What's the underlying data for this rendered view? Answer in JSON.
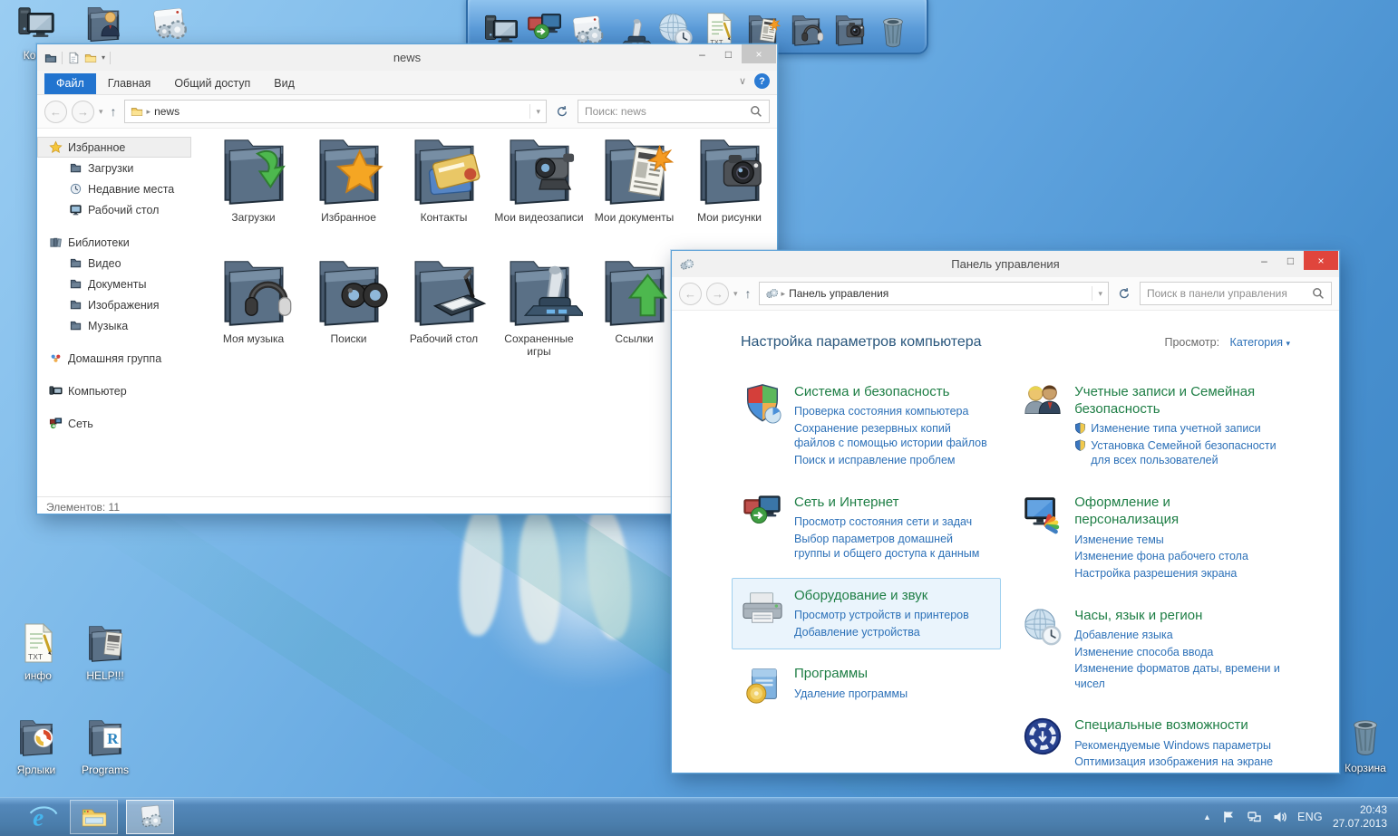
{
  "glyphs": {
    "minimize": "–",
    "maximize": "□",
    "close": "×",
    "help": "?",
    "ribbon_collapse": "∨",
    "back": "←",
    "forward": "→",
    "up": "↑",
    "dropdown": "▾",
    "breadcrumb": "▸",
    "tray_expand": "▲"
  },
  "desktop": {
    "top_icons": [
      {
        "label": "Комп",
        "icon": "computer"
      },
      {
        "label": "",
        "icon": "user-folder"
      },
      {
        "label": "",
        "icon": "settings-box"
      }
    ],
    "bottom_left_icons": [
      {
        "label": "инфо",
        "icon": "txt-file"
      },
      {
        "label": "HELP!!!",
        "icon": "help-folder"
      },
      {
        "label": "Ярлыки",
        "icon": "shortcuts-folder"
      },
      {
        "label": "Programs",
        "icon": "programs-folder"
      }
    ],
    "recycle_bin": {
      "label": "Корзина",
      "icon": "recycle-bin"
    }
  },
  "dock": {
    "icons": [
      "computer",
      "network-places",
      "settings-box",
      "joystick-device",
      "globe-clock",
      "txt-file",
      "folder-news",
      "folder-music",
      "folder-photo",
      "recycle-bin"
    ]
  },
  "news_window": {
    "title": "news",
    "tabs": [
      {
        "label": "Файл",
        "active": true
      },
      {
        "label": "Главная",
        "active": false
      },
      {
        "label": "Общий доступ",
        "active": false
      },
      {
        "label": "Вид",
        "active": false
      }
    ],
    "address": "news",
    "search_placeholder": "Поиск: news",
    "sidebar": [
      {
        "label": "Избранное",
        "icon": "star-mini",
        "level": 0,
        "selected": true,
        "gap": false
      },
      {
        "label": "Загрузки",
        "icon": "folder-mini",
        "level": 1,
        "selected": false,
        "gap": false
      },
      {
        "label": "Недавние места",
        "icon": "recent-mini",
        "level": 1,
        "selected": false,
        "gap": false
      },
      {
        "label": "Рабочий стол",
        "icon": "monitor-mini",
        "level": 1,
        "selected": false,
        "gap": false
      },
      {
        "label": "Библиотеки",
        "icon": "libraries-mini",
        "level": 0,
        "selected": false,
        "gap": true
      },
      {
        "label": "Видео",
        "icon": "folder-mini",
        "level": 1,
        "selected": false,
        "gap": false
      },
      {
        "label": "Документы",
        "icon": "folder-mini",
        "level": 1,
        "selected": false,
        "gap": false
      },
      {
        "label": "Изображения",
        "icon": "folder-mini",
        "level": 1,
        "selected": false,
        "gap": false
      },
      {
        "label": "Музыка",
        "icon": "folder-mini",
        "level": 1,
        "selected": false,
        "gap": false
      },
      {
        "label": "Домашняя группа",
        "icon": "homegroup-mini",
        "level": 0,
        "selected": false,
        "gap": true
      },
      {
        "label": "Компьютер",
        "icon": "computer-mini",
        "level": 0,
        "selected": false,
        "gap": true
      },
      {
        "label": "Сеть",
        "icon": "network-mini",
        "level": 0,
        "selected": false,
        "gap": true
      }
    ],
    "tiles": [
      {
        "label": "Загрузки",
        "icon": "download"
      },
      {
        "label": "Избранное",
        "icon": "star"
      },
      {
        "label": "Контакты",
        "icon": "card"
      },
      {
        "label": "Мои видеозаписи",
        "icon": "camcorder"
      },
      {
        "label": "Мои документы",
        "icon": "newspaper"
      },
      {
        "label": "Мои рисунки",
        "icon": "camera"
      },
      {
        "label": "Моя музыка",
        "icon": "headphones"
      },
      {
        "label": "Поиски",
        "icon": "binoculars"
      },
      {
        "label": "Рабочий стол",
        "icon": "tablet"
      },
      {
        "label": "Сохраненные игры",
        "icon": "joystick"
      },
      {
        "label": "Ссылки",
        "icon": "uparrow"
      }
    ],
    "status": "Элементов: 11"
  },
  "control_panel": {
    "title": "Панель управления",
    "address": "Панель управления",
    "search_placeholder": "Поиск в панели управления",
    "heading": "Настройка параметров компьютера",
    "view_label": "Просмотр:",
    "view_value": "Категория",
    "left_categories": [
      {
        "icon": "cp-shield",
        "title": "Система и безопасность",
        "highlighted": false,
        "links": [
          {
            "text": "Проверка состояния компьютера",
            "shield": false
          },
          {
            "text": "Сохранение резервных копий файлов с помощью истории файлов",
            "shield": false
          },
          {
            "text": "Поиск и исправление проблем",
            "shield": false
          }
        ]
      },
      {
        "icon": "cp-network",
        "title": "Сеть и Интернет",
        "highlighted": false,
        "links": [
          {
            "text": "Просмотр состояния сети и задач",
            "shield": false
          },
          {
            "text": "Выбор параметров домашней группы и общего доступа к данным",
            "shield": false
          }
        ]
      },
      {
        "icon": "cp-printer",
        "title": "Оборудование и звук",
        "highlighted": true,
        "links": [
          {
            "text": "Просмотр устройств и принтеров",
            "shield": false
          },
          {
            "text": "Добавление устройства",
            "shield": false
          }
        ]
      },
      {
        "icon": "cp-programs",
        "title": "Программы",
        "highlighted": false,
        "links": [
          {
            "text": "Удаление программы",
            "shield": false
          }
        ]
      }
    ],
    "right_categories": [
      {
        "icon": "cp-users",
        "title": "Учетные записи и Семейная безопасность",
        "highlighted": false,
        "links": [
          {
            "text": "Изменение типа учетной записи",
            "shield": true
          },
          {
            "text": "Установка Семейной безопасности для всех пользователей",
            "shield": true
          }
        ]
      },
      {
        "icon": "cp-personalization",
        "title": "Оформление и персонализация",
        "highlighted": false,
        "links": [
          {
            "text": "Изменение темы",
            "shield": false
          },
          {
            "text": "Изменение фона рабочего стола",
            "shield": false
          },
          {
            "text": "Настройка разрешения экрана",
            "shield": false
          }
        ]
      },
      {
        "icon": "cp-globeclock",
        "title": "Часы, язык и регион",
        "highlighted": false,
        "links": [
          {
            "text": "Добавление языка",
            "shield": false
          },
          {
            "text": "Изменение способа ввода",
            "shield": false
          },
          {
            "text": "Изменение форматов даты, времени и чисел",
            "shield": false
          }
        ]
      },
      {
        "icon": "cp-ease",
        "title": "Специальные возможности",
        "highlighted": false,
        "links": [
          {
            "text": "Рекомендуемые Windows параметры",
            "shield": false
          },
          {
            "text": "Оптимизация изображения на экране",
            "shield": false
          }
        ]
      }
    ],
    "colors": {
      "category_green": "#1e7e45",
      "link_blue": "#2d71b8",
      "heading_blue": "#29567c",
      "highlight_bg": "#eaf4fc",
      "highlight_border": "#9fd0ef"
    }
  },
  "taskbar": {
    "buttons": [
      {
        "icon": "ie",
        "state": "normal"
      },
      {
        "icon": "explorer",
        "state": "open"
      },
      {
        "icon": "control-panel",
        "state": "active"
      }
    ],
    "tray_icons": [
      "tray-flag",
      "tray-network",
      "tray-volume"
    ],
    "language": "ENG",
    "time": "20:43",
    "date": "27.07.2013"
  }
}
